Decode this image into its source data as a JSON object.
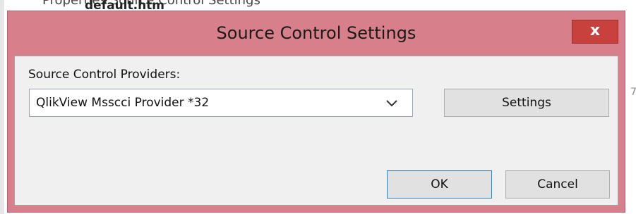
{
  "background": {
    "top_text": "Properties Source Control Settings",
    "file_name": "default.htm",
    "side_text": "7"
  },
  "dialog": {
    "title": "Source Control Settings",
    "close_label": "x",
    "providers_label": "Source Control Providers:",
    "provider_selected": "QlikView Msscci Provider *32",
    "settings_label": "Settings",
    "ok_label": "OK",
    "cancel_label": "Cancel"
  },
  "colors": {
    "titlebar": "#d77f8b",
    "close_button": "#c8413c",
    "client_area": "#f0f0f0",
    "default_button_border": "#3c7fb1"
  }
}
